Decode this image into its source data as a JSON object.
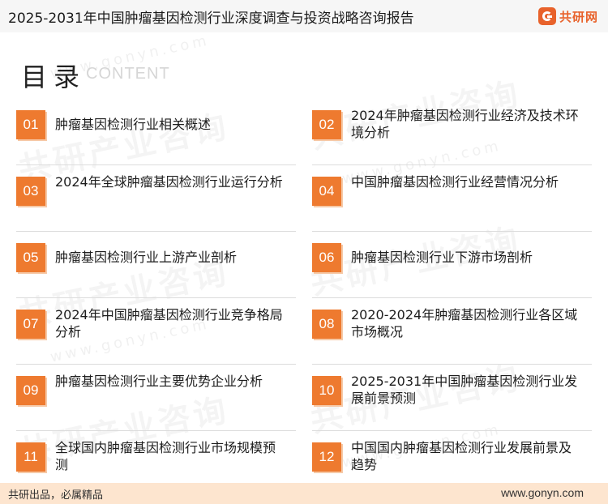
{
  "header": {
    "title": "2025-2031年中国肿瘤基因检测行业深度调查与投资战略咨询报告",
    "brand": "共研网"
  },
  "toc": {
    "title": "目录",
    "subtitle": "CONTENT",
    "items": [
      {
        "num": "01",
        "label": "肿瘤基因检测行业相关概述"
      },
      {
        "num": "02",
        "label": "2024年肿瘤基因检测行业经济及技术环境分析"
      },
      {
        "num": "03",
        "label": "2024年全球肿瘤基因检测行业运行分析"
      },
      {
        "num": "04",
        "label": "中国肿瘤基因检测行业经营情况分析"
      },
      {
        "num": "05",
        "label": "肿瘤基因检测行业上游产业剖析"
      },
      {
        "num": "06",
        "label": "肿瘤基因检测行业下游市场剖析"
      },
      {
        "num": "07",
        "label": "2024年中国肿瘤基因检测行业竞争格局分析"
      },
      {
        "num": "08",
        "label": "2020-2024年肿瘤基因检测行业各区域市场概况"
      },
      {
        "num": "09",
        "label": "肿瘤基因检测行业主要优势企业分析"
      },
      {
        "num": "10",
        "label": "2025-2031年中国肿瘤基因检测行业发展前景预测"
      },
      {
        "num": "11",
        "label": "全球国内肿瘤基因检测行业市场规模预测"
      },
      {
        "num": "12",
        "label": "中国国内肿瘤基因检测行业发展前景及趋势"
      }
    ]
  },
  "watermark": {
    "text": "共研产业咨询",
    "url": "www.gonyn.com"
  },
  "footer": {
    "left": "共研出品，必属精品",
    "right": "www.gonyn.com"
  },
  "colors": {
    "accent": "#ee7a2f",
    "brand": "#e8622b",
    "footer_bg": "#fde5cf"
  }
}
